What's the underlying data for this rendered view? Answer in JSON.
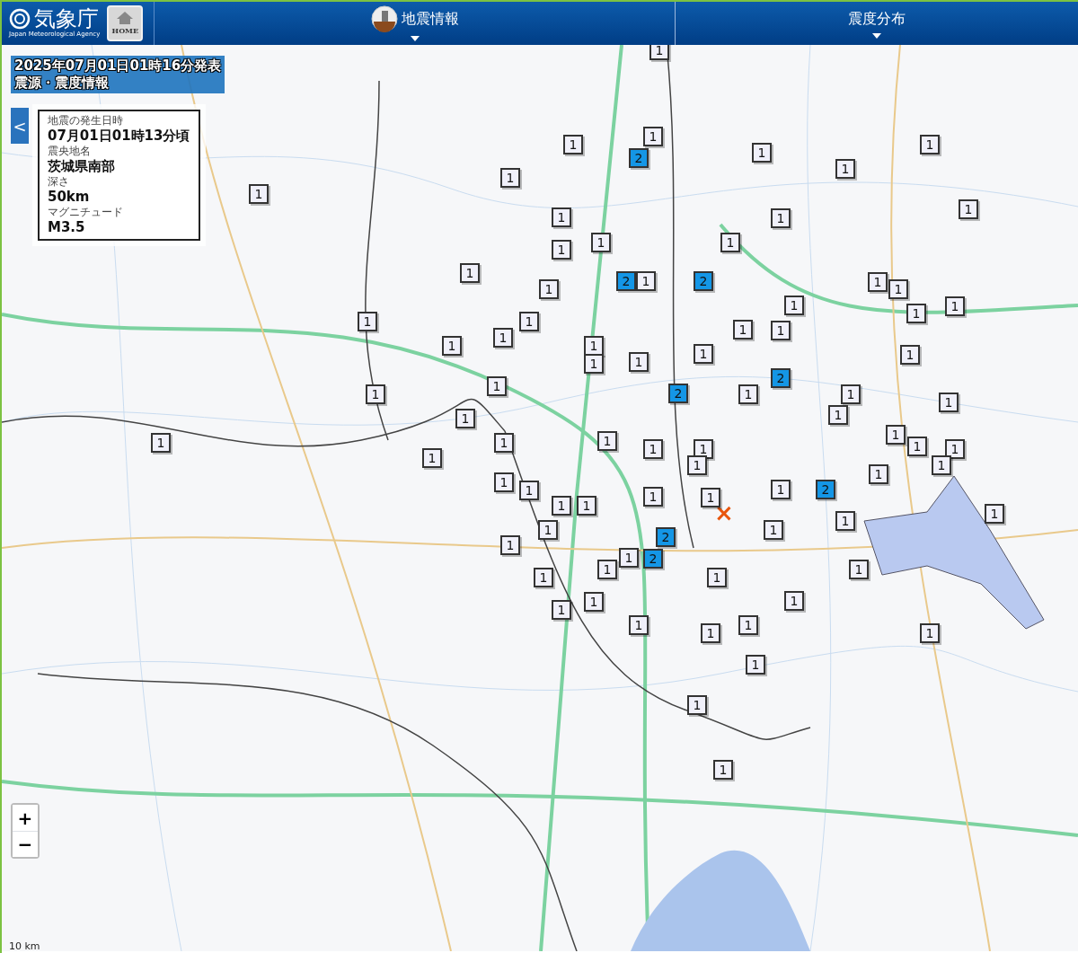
{
  "header": {
    "logo_text": "気象庁",
    "logo_subtitle": "Japan Meteorological Agency",
    "home_button": "HOME",
    "menus": [
      {
        "label": "地震情報",
        "kind": "icon"
      },
      {
        "label": "震度分布",
        "kind": "plain"
      }
    ]
  },
  "title_lines": [
    "2025年07月01日01時16分発表",
    "震源・震度情報"
  ],
  "info_panel": {
    "toggle": "<",
    "fields": [
      {
        "label": "地震の発生日時",
        "value": "07月01日01時13分頃"
      },
      {
        "label": "震央地名",
        "value": "茨城県南部"
      },
      {
        "label": "深さ",
        "value": "50km"
      },
      {
        "label": "マグニチュード",
        "value": "M3.5"
      }
    ]
  },
  "epicenter": {
    "mark": "×"
  },
  "markers": [
    {
      "intensity": "1",
      "color": "#f0f0fa"
    },
    {
      "intensity": "1",
      "color": "#f0f0fa"
    },
    {
      "intensity": "1",
      "color": "#f0f0fa"
    },
    {
      "intensity": "2",
      "color": "#1496e6"
    },
    {
      "intensity": "1",
      "color": "#f0f0fa"
    },
    {
      "intensity": "1",
      "color": "#f0f0fa"
    },
    {
      "intensity": "1",
      "color": "#f0f0fa"
    },
    {
      "intensity": "1",
      "color": "#f0f0fa"
    },
    {
      "intensity": "1",
      "color": "#f0f0fa"
    },
    {
      "intensity": "1",
      "color": "#f0f0fa"
    },
    {
      "intensity": "1",
      "color": "#f0f0fa"
    },
    {
      "intensity": "1",
      "color": "#f0f0fa"
    },
    {
      "intensity": "1",
      "color": "#f0f0fa"
    },
    {
      "intensity": "1",
      "color": "#f0f0fa"
    },
    {
      "intensity": "1",
      "color": "#f0f0fa"
    },
    {
      "intensity": "1",
      "color": "#f0f0fa"
    },
    {
      "intensity": "2",
      "color": "#1496e6"
    },
    {
      "intensity": "1",
      "color": "#f0f0fa"
    },
    {
      "intensity": "2",
      "color": "#1496e6"
    },
    {
      "intensity": "1",
      "color": "#f0f0fa"
    },
    {
      "intensity": "1",
      "color": "#f0f0fa"
    },
    {
      "intensity": "1",
      "color": "#f0f0fa"
    },
    {
      "intensity": "1",
      "color": "#f0f0fa"
    },
    {
      "intensity": "1",
      "color": "#f0f0fa"
    },
    {
      "intensity": "1",
      "color": "#f0f0fa"
    },
    {
      "intensity": "1",
      "color": "#f0f0fa"
    },
    {
      "intensity": "1",
      "color": "#f0f0fa"
    },
    {
      "intensity": "1",
      "color": "#f0f0fa"
    },
    {
      "intensity": "1",
      "color": "#f0f0fa"
    },
    {
      "intensity": "1",
      "color": "#f0f0fa"
    },
    {
      "intensity": "1",
      "color": "#f0f0fa"
    },
    {
      "intensity": "1",
      "color": "#f0f0fa"
    },
    {
      "intensity": "1",
      "color": "#f0f0fa"
    },
    {
      "intensity": "1",
      "color": "#f0f0fa"
    },
    {
      "intensity": "1",
      "color": "#f0f0fa"
    },
    {
      "intensity": "1",
      "color": "#f0f0fa"
    },
    {
      "intensity": "2",
      "color": "#1496e6"
    },
    {
      "intensity": "1",
      "color": "#f0f0fa"
    },
    {
      "intensity": "1",
      "color": "#f0f0fa"
    },
    {
      "intensity": "2",
      "color": "#1496e6"
    },
    {
      "intensity": "1",
      "color": "#f0f0fa"
    },
    {
      "intensity": "1",
      "color": "#f0f0fa"
    },
    {
      "intensity": "1",
      "color": "#f0f0fa"
    },
    {
      "intensity": "1",
      "color": "#f0f0fa"
    },
    {
      "intensity": "1",
      "color": "#f0f0fa"
    },
    {
      "intensity": "1",
      "color": "#f0f0fa"
    },
    {
      "intensity": "1",
      "color": "#f0f0fa"
    },
    {
      "intensity": "1",
      "color": "#f0f0fa"
    },
    {
      "intensity": "1",
      "color": "#f0f0fa"
    },
    {
      "intensity": "1",
      "color": "#f0f0fa"
    },
    {
      "intensity": "1",
      "color": "#f0f0fa"
    },
    {
      "intensity": "1",
      "color": "#f0f0fa"
    },
    {
      "intensity": "1",
      "color": "#f0f0fa"
    },
    {
      "intensity": "1",
      "color": "#f0f0fa"
    },
    {
      "intensity": "1",
      "color": "#f0f0fa"
    },
    {
      "intensity": "1",
      "color": "#f0f0fa"
    },
    {
      "intensity": "1",
      "color": "#f0f0fa"
    },
    {
      "intensity": "1",
      "color": "#f0f0fa"
    },
    {
      "intensity": "1",
      "color": "#f0f0fa"
    },
    {
      "intensity": "1",
      "color": "#f0f0fa"
    },
    {
      "intensity": "2",
      "color": "#1496e6"
    },
    {
      "intensity": "1",
      "color": "#f0f0fa"
    },
    {
      "intensity": "1",
      "color": "#f0f0fa"
    },
    {
      "intensity": "1",
      "color": "#f0f0fa"
    },
    {
      "intensity": "1",
      "color": "#f0f0fa"
    },
    {
      "intensity": "1",
      "color": "#f0f0fa"
    },
    {
      "intensity": "1",
      "color": "#f0f0fa"
    },
    {
      "intensity": "1",
      "color": "#f0f0fa"
    },
    {
      "intensity": "2",
      "color": "#1496e6"
    },
    {
      "intensity": "2",
      "color": "#1496e6"
    },
    {
      "intensity": "1",
      "color": "#f0f0fa"
    },
    {
      "intensity": "1",
      "color": "#f0f0fa"
    },
    {
      "intensity": "1",
      "color": "#f0f0fa"
    },
    {
      "intensity": "1",
      "color": "#f0f0fa"
    },
    {
      "intensity": "1",
      "color": "#f0f0fa"
    },
    {
      "intensity": "1",
      "color": "#f0f0fa"
    },
    {
      "intensity": "1",
      "color": "#f0f0fa"
    },
    {
      "intensity": "1",
      "color": "#f0f0fa"
    },
    {
      "intensity": "1",
      "color": "#f0f0fa"
    },
    {
      "intensity": "1",
      "color": "#f0f0fa"
    },
    {
      "intensity": "1",
      "color": "#f0f0fa"
    },
    {
      "intensity": "1",
      "color": "#f0f0fa"
    },
    {
      "intensity": "1",
      "color": "#f0f0fa"
    },
    {
      "intensity": "1",
      "color": "#f0f0fa"
    },
    {
      "intensity": "1",
      "color": "#f0f0fa"
    },
    {
      "intensity": "1",
      "color": "#f0f0fa"
    },
    {
      "intensity": "1",
      "color": "#f0f0fa"
    }
  ],
  "zoom_controls": [
    "+",
    "−"
  ],
  "scale": "10 km"
}
